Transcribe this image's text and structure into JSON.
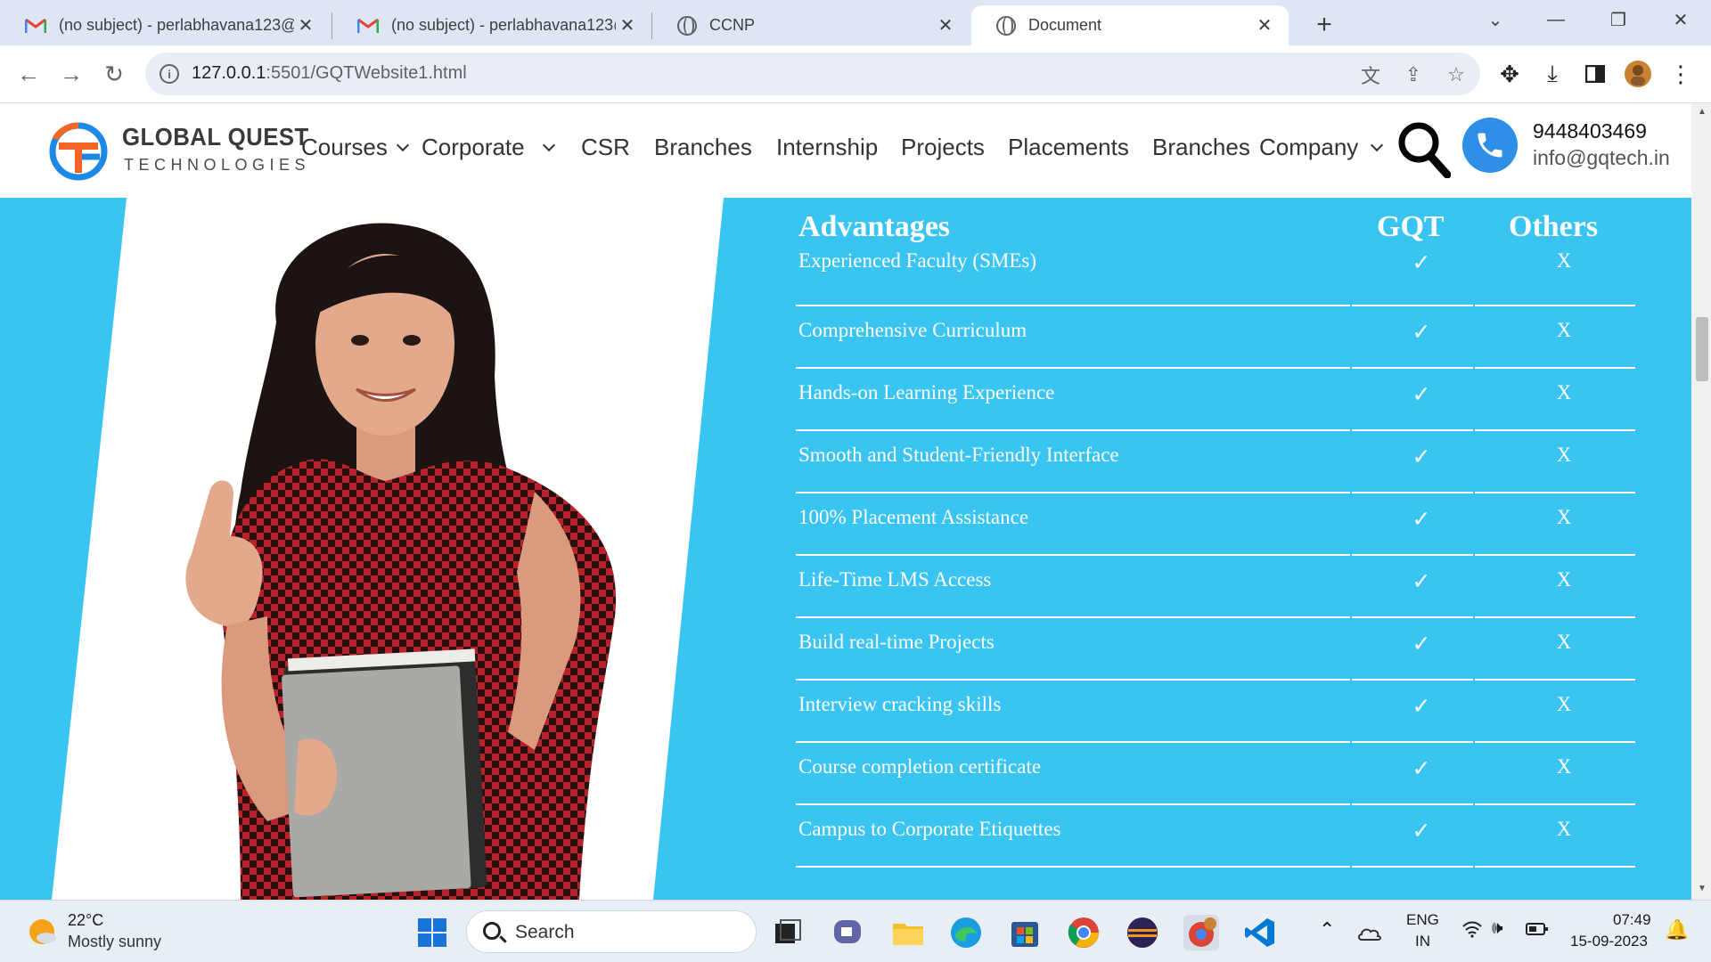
{
  "browser": {
    "tabs": [
      {
        "title": "(no subject) - perlabhavana123@",
        "icon": "gmail-icon",
        "active": false
      },
      {
        "title": "(no subject) - perlabhavana123@",
        "icon": "gmail-icon",
        "active": false
      },
      {
        "title": "CCNP",
        "icon": "globe-icon",
        "active": false
      },
      {
        "title": "Document",
        "icon": "globe-icon",
        "active": true
      }
    ],
    "url_host": "127.0.0.1",
    "url_rest": ":5501/GQTWebsite1.html"
  },
  "site": {
    "brand_name": "GLOBAL QUEST",
    "brand_sub": "TECHNOLOGIES",
    "nav": [
      "Courses",
      "Corporate",
      "CSR",
      "Branches",
      "Internship",
      "Projects",
      "Placements",
      "Branches",
      "Company"
    ],
    "phone": "9448403469",
    "email": "info@gqtech.in",
    "colors": {
      "hero_bg": "#39c4f2",
      "logo_orange": "#f26522",
      "logo_blue": "#1e88e5",
      "phone_blue": "#2f8fe6"
    }
  },
  "advantages": {
    "header": {
      "col1": "Advantages",
      "col2": "GQT",
      "col3": "Others"
    },
    "check_symbol": "✓",
    "cross_symbol": "X",
    "rows": [
      "Experienced Faculty (SMEs)",
      "Comprehensive Curriculum",
      "Hands-on Learning Experience",
      "Smooth and Student-Friendly Interface",
      "100% Placement Assistance",
      "Life-Time LMS Access",
      "Build real-time Projects",
      "Interview cracking skills",
      "Course completion certificate",
      "Campus to Corporate Etiquettes"
    ]
  },
  "taskbar": {
    "weather_temp": "22°C",
    "weather_desc": "Mostly sunny",
    "search_label": "Search",
    "lang_top": "ENG",
    "lang_bottom": "IN",
    "time": "07:49",
    "date": "15-09-2023"
  }
}
